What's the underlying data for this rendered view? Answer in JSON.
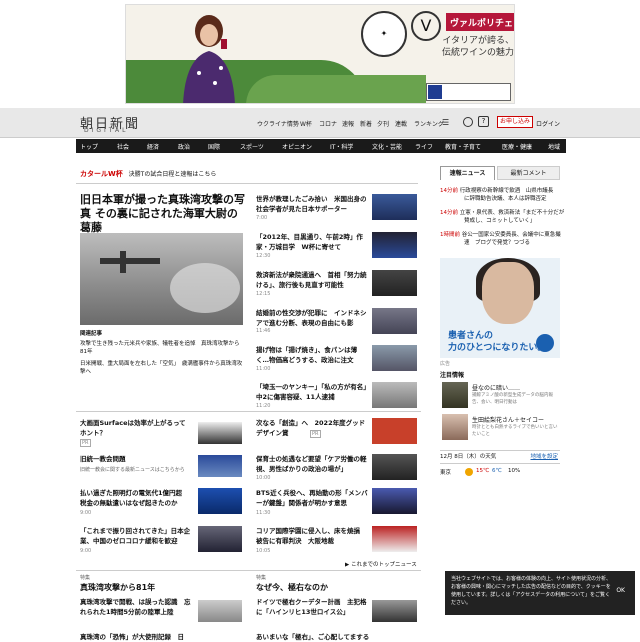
{
  "ad": {
    "title": "ヴァルポリチェッラ:",
    "line1": "イタリアが誇る、",
    "line2": "伝統ワインの魅力",
    "logo_mark": "V"
  },
  "header": {
    "logo": "朝日新聞",
    "logo_sub": "DIGITAL",
    "util": [
      "ウクライナ情勢",
      "W杯",
      "コロナ",
      "速報",
      "新着",
      "夕刊",
      "連載",
      "ランキング"
    ],
    "help": "?",
    "signup": "お申し込み",
    "login": "ログイン"
  },
  "nav": [
    "トップ",
    "社会",
    "経済",
    "政治",
    "国際",
    "スポーツ",
    "オピニオン",
    "IT・科学",
    "文化・芸能",
    "ライフ",
    "教育・子育て",
    "地域"
  ],
  "breaking": {
    "tag": "カタールW杯",
    "text": "決勝Tの試合日程と速報はこちら"
  },
  "lead": {
    "headline": "旧日本軍が撮った真珠湾攻撃の写真 その裏に記された海軍大尉の葛藤",
    "time": "12:15",
    "related_label": "関連記事",
    "related": [
      "攻撃で生き残った元米兵や家族、犠牲者を追悼　真珠湾攻撃から81年",
      "日米開戦、重大局面を左右した「空気」　歳满艦事件から真珠湾攻撃へ"
    ]
  },
  "mid_items": [
    {
      "title": "世界が教理したごみ拾い　米国出身の社会学者が見た日本サポーター",
      "time": "7:00"
    },
    {
      "title": "「2012年、目黒通り、午前2時」作家・万城目学　W杯に寄せて",
      "time": "12:30"
    },
    {
      "title": "救済新法が衆院通過へ　首相「努力続ける」、旅行後も見直す可能性",
      "time": "12:15"
    },
    {
      "title": "結婚前の性交渉が犯罪に　インドネシアで進む分断、表現の自由にも影",
      "time": "11:46"
    },
    {
      "title": "揚げ物は「揚げ焼き」、食パンは薄く…物価高どうする、政治に注文",
      "time": "11:00"
    },
    {
      "title": "「埼玉一のヤンキー」「私の方が有名」中2に傷害容疑、11人逮捕",
      "time": "11:20"
    }
  ],
  "left_items": [
    {
      "title": "大画面Surfaceは効率が上がるってホント？",
      "note": "PR"
    },
    {
      "title": "旧統一教会問題",
      "sub": "旧統一教会に関する最新ニュースはこちらから"
    },
    {
      "title": "払い過ぎた照明灯の電気代1億円超　税金の無駄遣いはなぜ起きたのか",
      "time": "9:00"
    },
    {
      "title": "「これまで振り回されてきた」日本企業、中国のゼロコロナ緩和を歓迎",
      "time": "9:00"
    }
  ],
  "right_items": [
    {
      "title": "次なる「創造」へ　2022年度グッドデザイン賞",
      "note": "PR"
    },
    {
      "title": "保育士の処遇など要望「ケア労働の軽視、男性ばかりの政治の場が」",
      "time": "10:00"
    },
    {
      "title": "BTS近く兵役へ、再始動の形「メンバーが鍵盤」関係者が明かす意思",
      "time": "11:30"
    },
    {
      "title": "コリア国際学園に侵入し、床を焼損　被告に有罪判決　大阪地裁",
      "time": "10:05"
    }
  ],
  "more_link": "▶ これまでのトップニュース",
  "sections": [
    {
      "label": "特集",
      "title": "真珠湾攻撃から81年",
      "item1": "真珠湾攻撃で開戦、は誤った認識　忘れられた1時間5分前の陸軍上陸",
      "item2": "真珠湾の「恐怖」が大使刑記録　日"
    },
    {
      "label": "特集",
      "title": "なぜ今、極右なのか",
      "item1": "ドイツで極右クーデター計画　主犯格に「ハインリヒ13世ロイス公」",
      "item2": "あいまいな「極右」、ご心配してまする"
    }
  ],
  "sidebar": {
    "tab1": "速報ニュース",
    "tab2": "最新コメント",
    "ranks": [
      {
        "time": "14分前",
        "title": "行政視察の新幹線で飲酒　山県市議長",
        "sub": "に辞職勧告決議、本人は辞職否定"
      },
      {
        "time": "14分前",
        "title": "立憲・泉代表、救済新法「まだ不十分だが",
        "sub": "賛成し、コミットしていく」"
      },
      {
        "time": "1時間前",
        "title": "谷公一国家公安委員長、会議中に東急撮",
        "sub": "速　ブログで発覚？つづる"
      }
    ],
    "ad_line1": "患者さんの",
    "ad_line2": "力のひとつになりたい。",
    "ad_label": "広告",
    "people_title": "注目情報",
    "people": [
      {
        "name": "昼なのに暗い……",
        "desc": "捕鯨アミノ酸の新型生成データの脳内報告、会い、明日行動は"
      },
      {
        "name": "生田絵梨花さん＋セイコー",
        "desc": "時計ととも白熱するライブで色いいと言いたいこと"
      }
    ],
    "weather_date": "12月 8日（木）の天気",
    "weather_link": "地域を設定",
    "city": "東京",
    "high": "15℃",
    "low": "6℃",
    "rain": "10%"
  },
  "cookie": {
    "text": "当社ウェブサイトでは、お客様の体験の向上、サイト使用状況の分析、お客様の興味・関心にマッチした広告の配信などの目的で、クッキーを使用しています。詳しくは「アクセスデータの利用について」をご覧ください。",
    "ok": "OK"
  }
}
